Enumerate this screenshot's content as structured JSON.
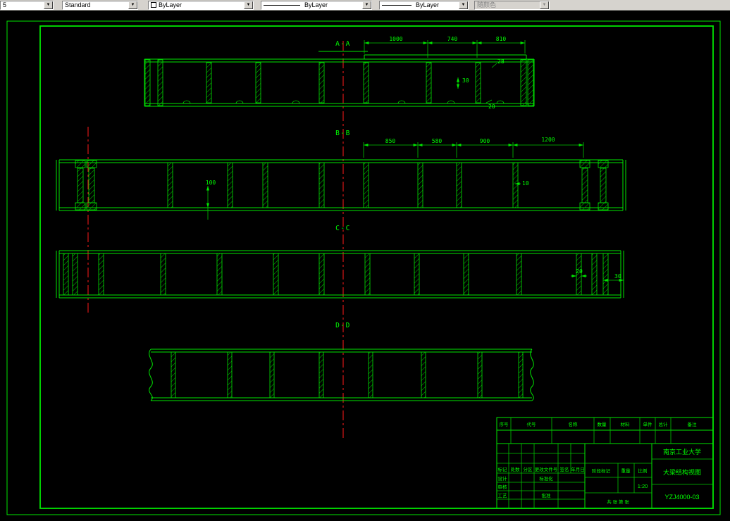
{
  "toolbar": {
    "dim_style": "5",
    "text_style": "Standard",
    "color": "ByLayer",
    "linetype": "ByLayer",
    "lineweight": "ByLayer",
    "plot_style": "随颜色"
  },
  "sections": {
    "a": "A-A",
    "b": "B-B",
    "c": "C-C",
    "d": "D-D"
  },
  "dims": {
    "a1": "1000",
    "a2": "740",
    "a3": "810",
    "a4": "30",
    "a5": "28",
    "a6": "20",
    "b1": "850",
    "b2": "580",
    "b3": "900",
    "b4": "1200",
    "b5": "100",
    "b6": "10",
    "c1": "20",
    "c2": "30"
  },
  "titleblock": {
    "university": "南京工业大学",
    "drawing_title": "大梁结构视图",
    "drawing_number": "YZJ4000-03",
    "scale_value": "1:20",
    "bom": {
      "no": "序号",
      "code": "代号",
      "name": "名称",
      "qty": "数量",
      "material": "材料",
      "single": "单件",
      "total": "总计",
      "note": "备注"
    },
    "fields": {
      "mark": "标记",
      "count": "处数",
      "zone": "分区",
      "change_doc": "更改文件号",
      "sign": "签名",
      "date": "年月日",
      "design": "设计",
      "standardize": "标准化",
      "review": "审核",
      "process": "工艺",
      "approve": "批准",
      "stage_mark": "阶段标记",
      "weight": "重量",
      "scale": "比例",
      "sheets": "共 张 第 张"
    }
  }
}
